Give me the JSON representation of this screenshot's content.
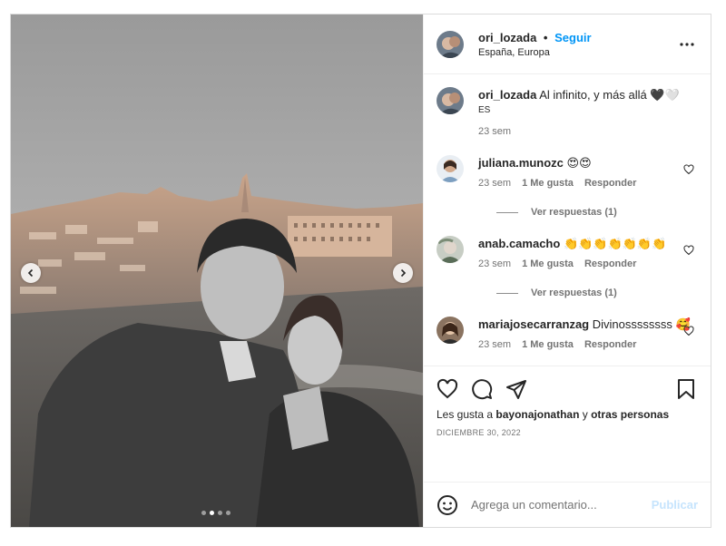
{
  "post": {
    "author": "ori_lozada",
    "separator": "•",
    "follow_label": "Seguir",
    "location": "España, Europa",
    "more_icon": "more-horizontal-icon"
  },
  "caption": {
    "author": "ori_lozada",
    "text": "Al infinito, y más allá 🖤🤍",
    "lang": "ES",
    "time": "23 sem"
  },
  "comments": [
    {
      "user": "juliana.munozc",
      "text": "😍😍",
      "time": "23 sem",
      "likes": "1 Me gusta",
      "reply": "Responder",
      "replies_label": "Ver respuestas (1)"
    },
    {
      "user": "anab.camacho",
      "text": "👏👏👏👏👏👏👏",
      "time": "23 sem",
      "likes": "1 Me gusta",
      "reply": "Responder",
      "replies_label": "Ver respuestas (1)"
    },
    {
      "user": "mariajosecarranzag",
      "text": "Divinossssssss 🥰",
      "time": "23 sem",
      "likes": "1 Me gusta",
      "reply": "Responder"
    }
  ],
  "engagement": {
    "likes_prefix": "Les gusta a",
    "liked_by": "bayonajonathan",
    "likes_middle": "y",
    "likes_suffix": "otras personas",
    "date": "DICIEMBRE 30, 2022"
  },
  "add_comment": {
    "placeholder": "Agrega un comentario...",
    "publish_label": "Publicar"
  },
  "carousel": {
    "slide_count": 4,
    "active_slide": 2
  },
  "colors": {
    "accent": "#0095f6",
    "publish_disabled": "#c6e4fd",
    "muted": "#737373",
    "border": "#dbdbdb"
  }
}
